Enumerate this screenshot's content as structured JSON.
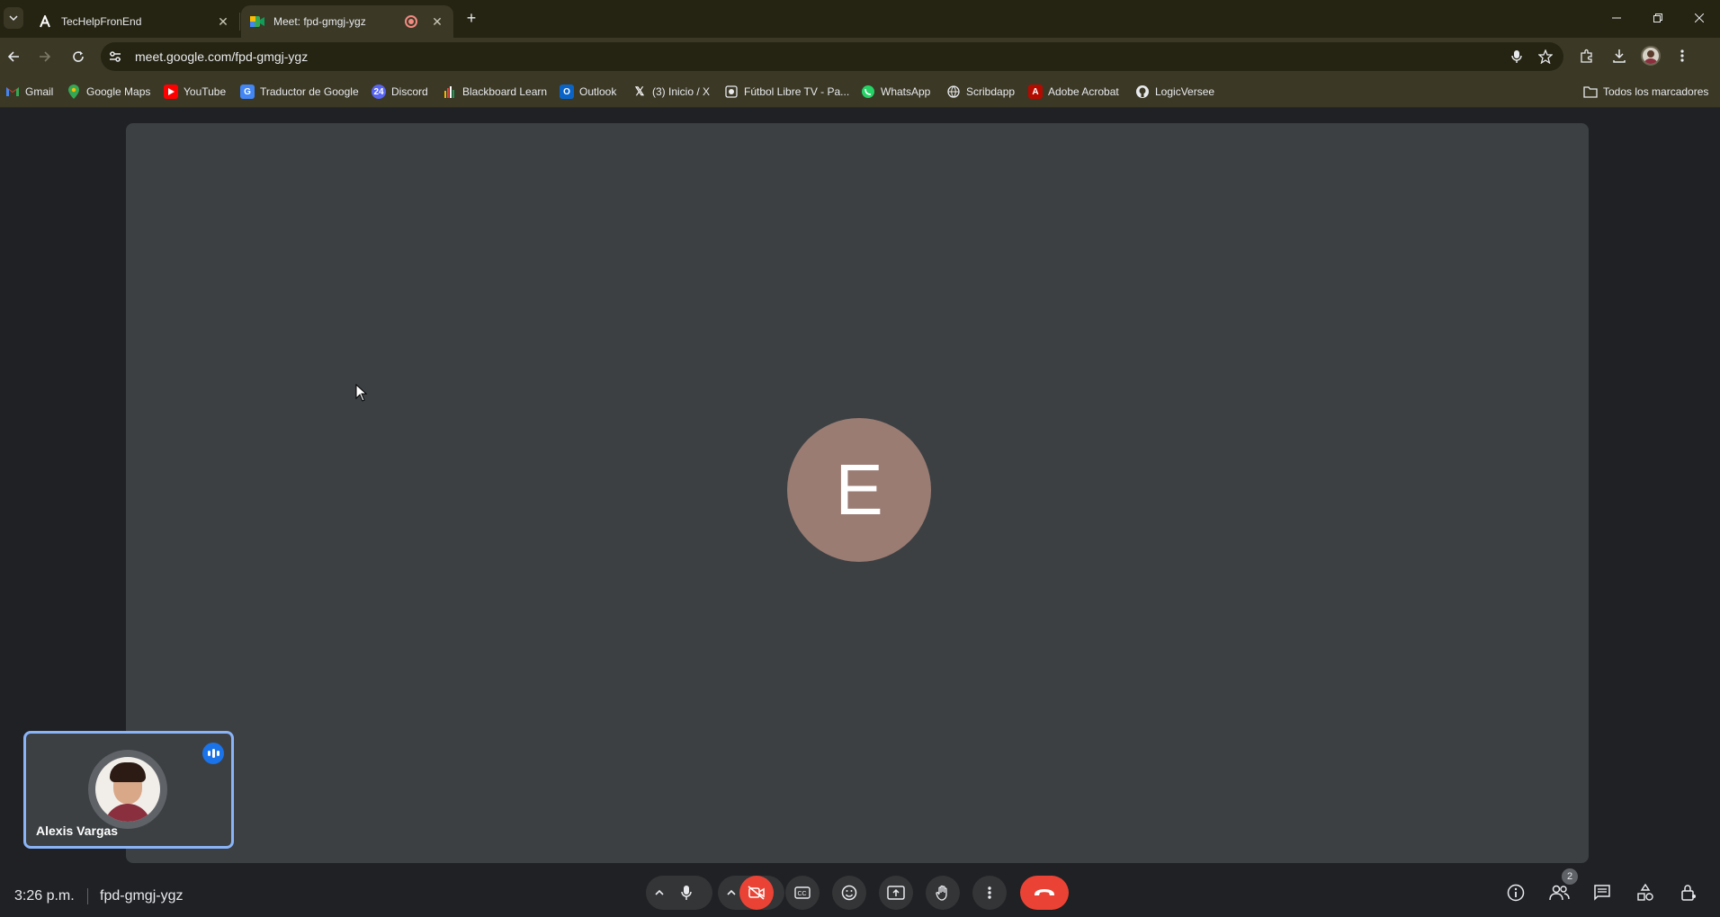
{
  "browser": {
    "tabs": [
      {
        "title": "TecHelpFronEnd",
        "active": false
      },
      {
        "title": "Meet: fpd-gmgj-ygz",
        "active": true
      }
    ],
    "url": "meet.google.com/fpd-gmgj-ygz",
    "bookmarks": [
      {
        "label": "Gmail",
        "icon": "gmail-icon"
      },
      {
        "label": "Google Maps",
        "icon": "maps-icon"
      },
      {
        "label": "YouTube",
        "icon": "youtube-icon"
      },
      {
        "label": "Traductor de Google",
        "icon": "translate-icon"
      },
      {
        "label": "Discord",
        "icon": "discord-icon"
      },
      {
        "label": "Blackboard Learn",
        "icon": "blackboard-icon"
      },
      {
        "label": "Outlook",
        "icon": "outlook-icon"
      },
      {
        "label": "(3) Inicio / X",
        "icon": "x-icon"
      },
      {
        "label": "Fútbol Libre TV - Pa...",
        "icon": "futbol-icon"
      },
      {
        "label": "WhatsApp",
        "icon": "whatsapp-icon"
      },
      {
        "label": "Scribdapp",
        "icon": "scribd-icon"
      },
      {
        "label": "Adobe Acrobat",
        "icon": "acrobat-icon"
      },
      {
        "label": "LogicVersee",
        "icon": "github-icon"
      }
    ],
    "all_bookmarks_label": "Todos los marcadores"
  },
  "meet": {
    "main_participant_initial": "E",
    "self_tile": {
      "name": "Alexis Vargas"
    },
    "time": "3:26 p.m.",
    "meeting_code": "fpd-gmgj-ygz",
    "participants_count": "2",
    "colors": {
      "stage": "#3c4043",
      "avatar": "#9a7c73",
      "end_call": "#ea4335",
      "self_border": "#8ab4f8"
    }
  }
}
